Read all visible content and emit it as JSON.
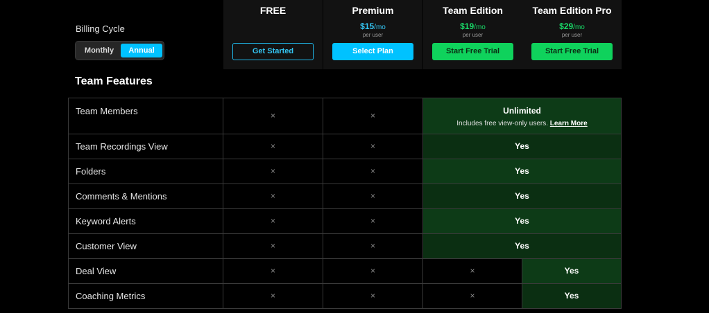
{
  "billing": {
    "label": "Billing Cycle",
    "options": [
      "Monthly",
      "Annual"
    ],
    "selected": "Annual"
  },
  "plans": [
    {
      "name": "FREE",
      "price": "",
      "period": "",
      "per_user": "",
      "button": "Get Started"
    },
    {
      "name": "Premium",
      "price": "$15",
      "period": "/mo",
      "per_user": "per user",
      "button": "Select Plan"
    },
    {
      "name": "Team Edition",
      "price": "$19",
      "period": "/mo",
      "per_user": "per user",
      "button": "Start Free Trial"
    },
    {
      "name": "Team Edition Pro",
      "price": "$29",
      "period": "/mo",
      "per_user": "per user",
      "button": "Start Free Trial"
    }
  ],
  "colors": {
    "accent_blue": "#00c2ff",
    "accent_green": "#0fd25c",
    "price_blue": "#34c6f4",
    "price_green": "#19d968"
  },
  "section_title": "Team Features",
  "unlimited": {
    "title": "Unlimited",
    "note": "Includes free view-only users.",
    "link": "Learn More"
  },
  "rows": [
    {
      "feature": "Team Members",
      "free": "×",
      "premium": "×",
      "team": "Unlimited",
      "pro": "Unlimited"
    },
    {
      "feature": "Team Recordings View",
      "free": "×",
      "premium": "×",
      "team": "Yes",
      "pro": "Yes"
    },
    {
      "feature": "Folders",
      "free": "×",
      "premium": "×",
      "team": "Yes",
      "pro": "Yes"
    },
    {
      "feature": "Comments & Mentions",
      "free": "×",
      "premium": "×",
      "team": "Yes",
      "pro": "Yes"
    },
    {
      "feature": "Keyword Alerts",
      "free": "×",
      "premium": "×",
      "team": "Yes",
      "pro": "Yes"
    },
    {
      "feature": "Customer View",
      "free": "×",
      "premium": "×",
      "team": "Yes",
      "pro": "Yes"
    },
    {
      "feature": "Deal View",
      "free": "×",
      "premium": "×",
      "team": "×",
      "pro": "Yes"
    },
    {
      "feature": "Coaching Metrics",
      "free": "×",
      "premium": "×",
      "team": "×",
      "pro": "Yes"
    }
  ]
}
